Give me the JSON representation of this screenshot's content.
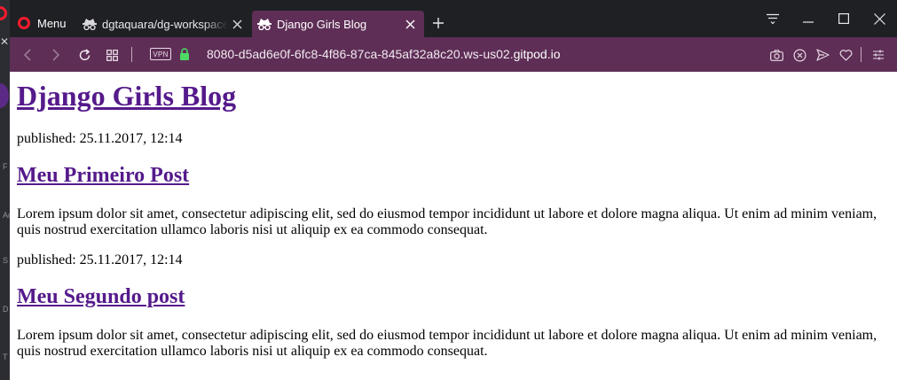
{
  "tabs": {
    "menu_label": "Menu",
    "inactive_title": "dgtaquara/dg-workspace - Gitpod",
    "active_title": "Django Girls Blog"
  },
  "address": {
    "vpn_label": "VPN",
    "url_prefix": "8080-d5ad6e0f-6fc8-4f86-87ca-845af32a8c20.ws-us02.",
    "url_domain": "gitpod.io"
  },
  "background_app": {
    "visible_letters": [
      "F",
      "Ac",
      "S",
      "D",
      "T"
    ]
  },
  "page": {
    "blog_title": "Django Girls Blog",
    "posts": [
      {
        "published": "published: 25.11.2017, 12:14",
        "title": "Meu Primeiro Post",
        "text": "Lorem ipsum dolor sit amet, consectetur adipiscing elit, sed do eiusmod tempor incididunt ut labore et dolore magna aliqua. Ut enim ad minim veniam, quis nostrud exercitation ullamco laboris nisi ut aliquip ex ea commodo consequat."
      },
      {
        "published": "published: 25.11.2017, 12:14",
        "title": "Meu Segundo post",
        "text": "Lorem ipsum dolor sit amet, consectetur adipiscing elit, sed do eiusmod tempor incididunt ut labore et dolore magna aliqua. Ut enim ad minim veniam, quis nostrud exercitation ullamco laboris nisi ut aliquip ex ea commodo consequat."
      }
    ]
  },
  "colors": {
    "tab_bar": "#1f2024",
    "accent": "#5e2e56",
    "link": "#551a8b",
    "opera_red": "#ff1b2d",
    "lock_green": "#4cd964"
  }
}
